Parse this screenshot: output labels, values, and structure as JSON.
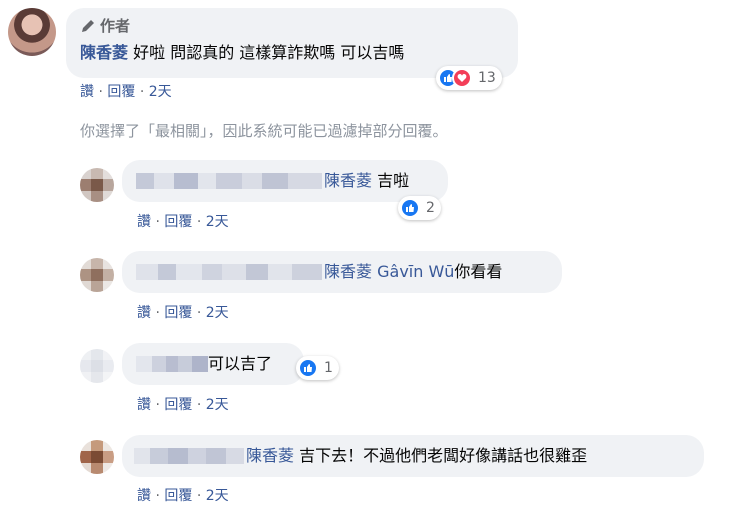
{
  "main_comment": {
    "author_tag": "作者",
    "author": "陳香菱",
    "text": "好啦 問認真的 這樣算詐欺嗎 可以吉嗎",
    "reaction_count": "13",
    "actions": {
      "like": "讚",
      "reply": "回覆",
      "time": "2天"
    }
  },
  "filter_notice": "你選擇了「最相關」，因此系統可能已過濾掉部分回覆。",
  "replies": [
    {
      "mention": "陳香菱",
      "text": "吉啦",
      "reaction_count": "2",
      "actions": {
        "like": "讚",
        "reply": "回覆",
        "time": "2天"
      }
    },
    {
      "mention": "陳香菱",
      "mention2": "Gâvīn Wū",
      "text": "你看看",
      "actions": {
        "like": "讚",
        "reply": "回覆",
        "time": "2天"
      }
    },
    {
      "text": "可以吉了",
      "reaction_count": "1",
      "actions": {
        "like": "讚",
        "reply": "回覆",
        "time": "2天"
      }
    },
    {
      "mention": "陳香菱",
      "text": "吉下去！不過他們老闆好像講話也很雞歪",
      "actions": {
        "like": "讚",
        "reply": "回覆",
        "time": "2天"
      }
    }
  ],
  "colors": {
    "link": "#385898",
    "bubble": "#f0f2f5",
    "like": "#1877f2",
    "love": "#f33e58"
  }
}
